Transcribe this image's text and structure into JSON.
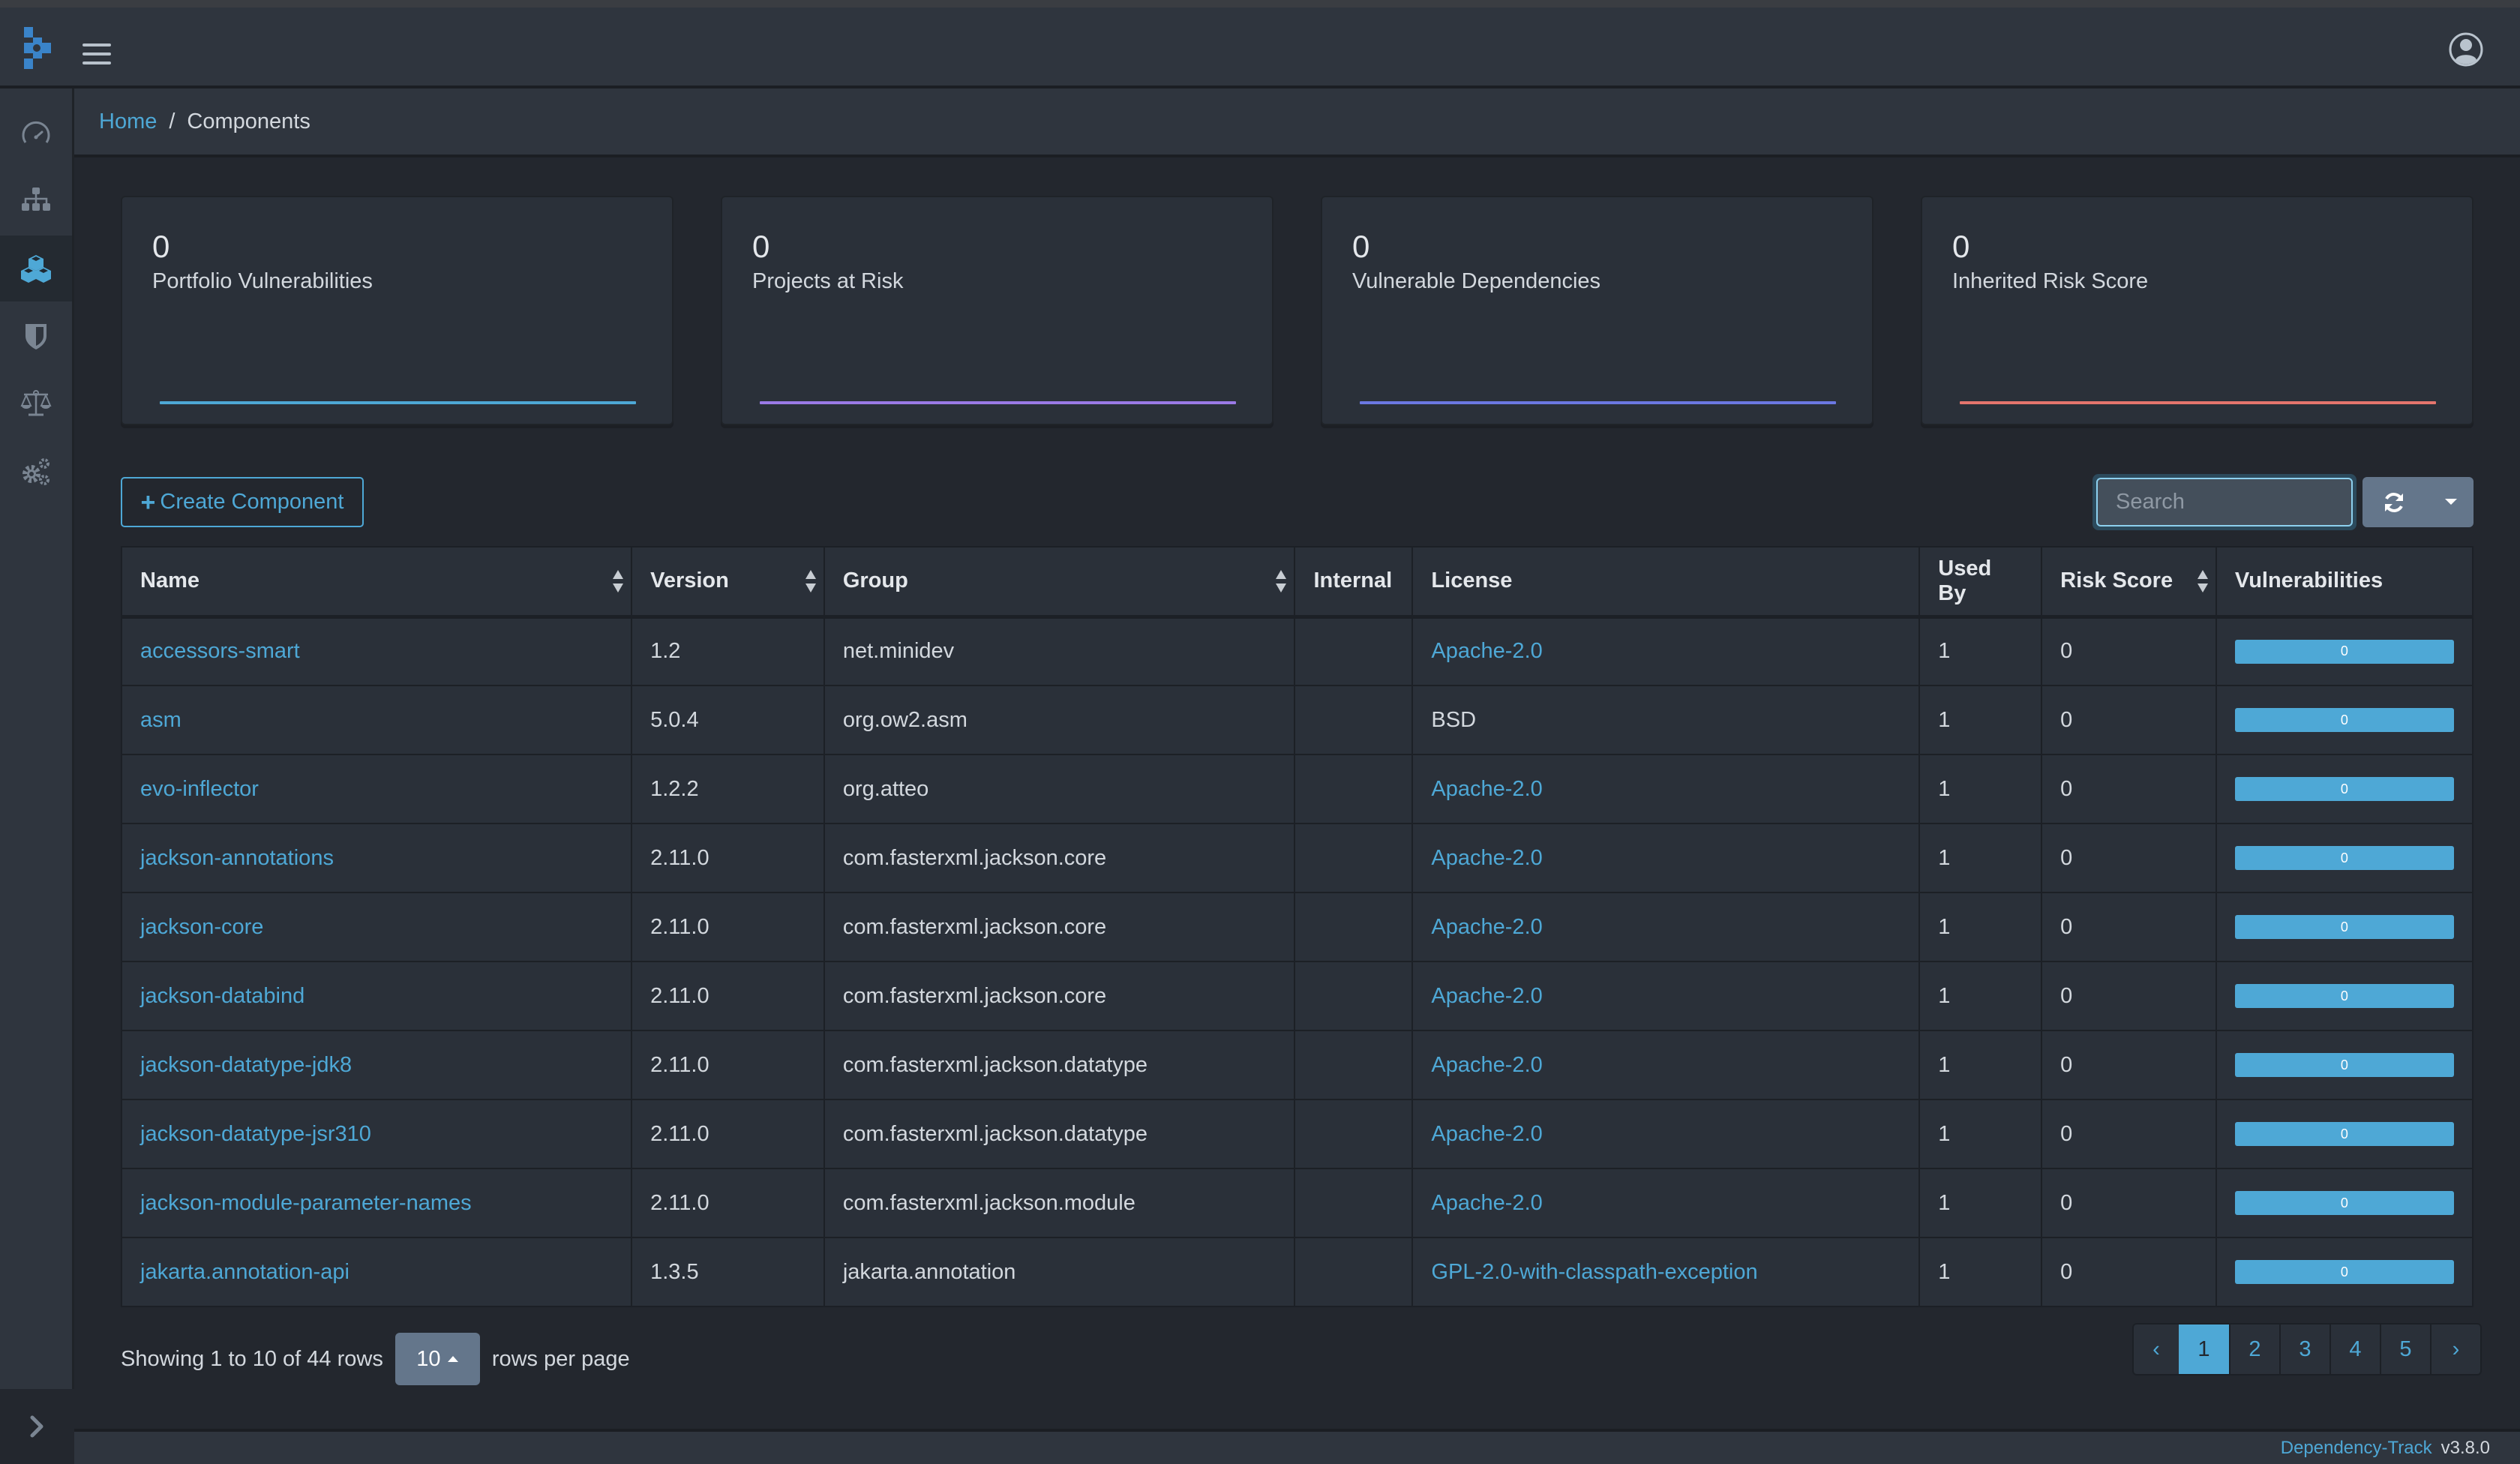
{
  "app": {
    "name": "Dependency-Track",
    "version": "v3.8.0"
  },
  "header": {
    "logo_icon": "dependency-track-logo",
    "menu_icon": "hamburger-icon",
    "user_icon": "user-circle-icon"
  },
  "sidebar": {
    "items": [
      {
        "id": "dashboard",
        "icon": "speedometer-icon",
        "active": false
      },
      {
        "id": "projects",
        "icon": "sitemap-icon",
        "active": false
      },
      {
        "id": "components",
        "icon": "cubes-icon",
        "active": true
      },
      {
        "id": "vulnerabilities",
        "icon": "shield-icon",
        "active": false
      },
      {
        "id": "licenses",
        "icon": "balance-scale-icon",
        "active": false
      },
      {
        "id": "administration",
        "icon": "gears-icon",
        "active": false
      }
    ],
    "toggle_icon": "chevron-right-icon"
  },
  "breadcrumb": {
    "home": "Home",
    "separator": "/",
    "current": "Components"
  },
  "cards": [
    {
      "value": "0",
      "label": "Portfolio Vulnerabilities",
      "color": "#4ea8d6"
    },
    {
      "value": "0",
      "label": "Projects at Risk",
      "color": "#9a7ae6"
    },
    {
      "value": "0",
      "label": "Vulnerable Dependencies",
      "color": "#6b78e2"
    },
    {
      "value": "0",
      "label": "Inherited Risk Score",
      "color": "#e5756d"
    }
  ],
  "toolbar": {
    "create_label": "Create Component",
    "create_icon": "plus-icon",
    "search_placeholder": "Search",
    "search_value": "",
    "refresh_icon": "refresh-icon",
    "columns_icon": "caret-down-icon"
  },
  "table": {
    "columns": [
      "Name",
      "Version",
      "Group",
      "Internal",
      "License",
      "Used By",
      "Risk Score",
      "Vulnerabilities"
    ],
    "rows": [
      {
        "name": "accessors-smart",
        "version": "1.2",
        "group": "net.minidev",
        "internal": "",
        "license": "Apache-2.0",
        "license_link": true,
        "used_by": "1",
        "risk_score": "0",
        "vulnerabilities": "0"
      },
      {
        "name": "asm",
        "version": "5.0.4",
        "group": "org.ow2.asm",
        "internal": "",
        "license": "BSD",
        "license_link": false,
        "used_by": "1",
        "risk_score": "0",
        "vulnerabilities": "0"
      },
      {
        "name": "evo-inflector",
        "version": "1.2.2",
        "group": "org.atteo",
        "internal": "",
        "license": "Apache-2.0",
        "license_link": true,
        "used_by": "1",
        "risk_score": "0",
        "vulnerabilities": "0"
      },
      {
        "name": "jackson-annotations",
        "version": "2.11.0",
        "group": "com.fasterxml.jackson.core",
        "internal": "",
        "license": "Apache-2.0",
        "license_link": true,
        "used_by": "1",
        "risk_score": "0",
        "vulnerabilities": "0"
      },
      {
        "name": "jackson-core",
        "version": "2.11.0",
        "group": "com.fasterxml.jackson.core",
        "internal": "",
        "license": "Apache-2.0",
        "license_link": true,
        "used_by": "1",
        "risk_score": "0",
        "vulnerabilities": "0"
      },
      {
        "name": "jackson-databind",
        "version": "2.11.0",
        "group": "com.fasterxml.jackson.core",
        "internal": "",
        "license": "Apache-2.0",
        "license_link": true,
        "used_by": "1",
        "risk_score": "0",
        "vulnerabilities": "0"
      },
      {
        "name": "jackson-datatype-jdk8",
        "version": "2.11.0",
        "group": "com.fasterxml.jackson.datatype",
        "internal": "",
        "license": "Apache-2.0",
        "license_link": true,
        "used_by": "1",
        "risk_score": "0",
        "vulnerabilities": "0"
      },
      {
        "name": "jackson-datatype-jsr310",
        "version": "2.11.0",
        "group": "com.fasterxml.jackson.datatype",
        "internal": "",
        "license": "Apache-2.0",
        "license_link": true,
        "used_by": "1",
        "risk_score": "0",
        "vulnerabilities": "0"
      },
      {
        "name": "jackson-module-parameter-names",
        "version": "2.11.0",
        "group": "com.fasterxml.jackson.module",
        "internal": "",
        "license": "Apache-2.0",
        "license_link": true,
        "used_by": "1",
        "risk_score": "0",
        "vulnerabilities": "0"
      },
      {
        "name": "jakarta.annotation-api",
        "version": "1.3.5",
        "group": "jakarta.annotation",
        "internal": "",
        "license": "GPL-2.0-with-classpath-exception",
        "license_link": true,
        "used_by": "1",
        "risk_score": "0",
        "vulnerabilities": "0"
      }
    ]
  },
  "pagination": {
    "showing_text": "Showing 1 to 10 of 44 rows",
    "per_page": "10",
    "per_page_suffix": "rows per page",
    "prev": "‹",
    "next": "›",
    "pages": [
      "1",
      "2",
      "3",
      "4",
      "5"
    ],
    "current_page": "1"
  },
  "colors": {
    "accent": "#4ea8d6",
    "background": "#23272e",
    "panel": "#2f353e",
    "card": "#2a3039"
  }
}
